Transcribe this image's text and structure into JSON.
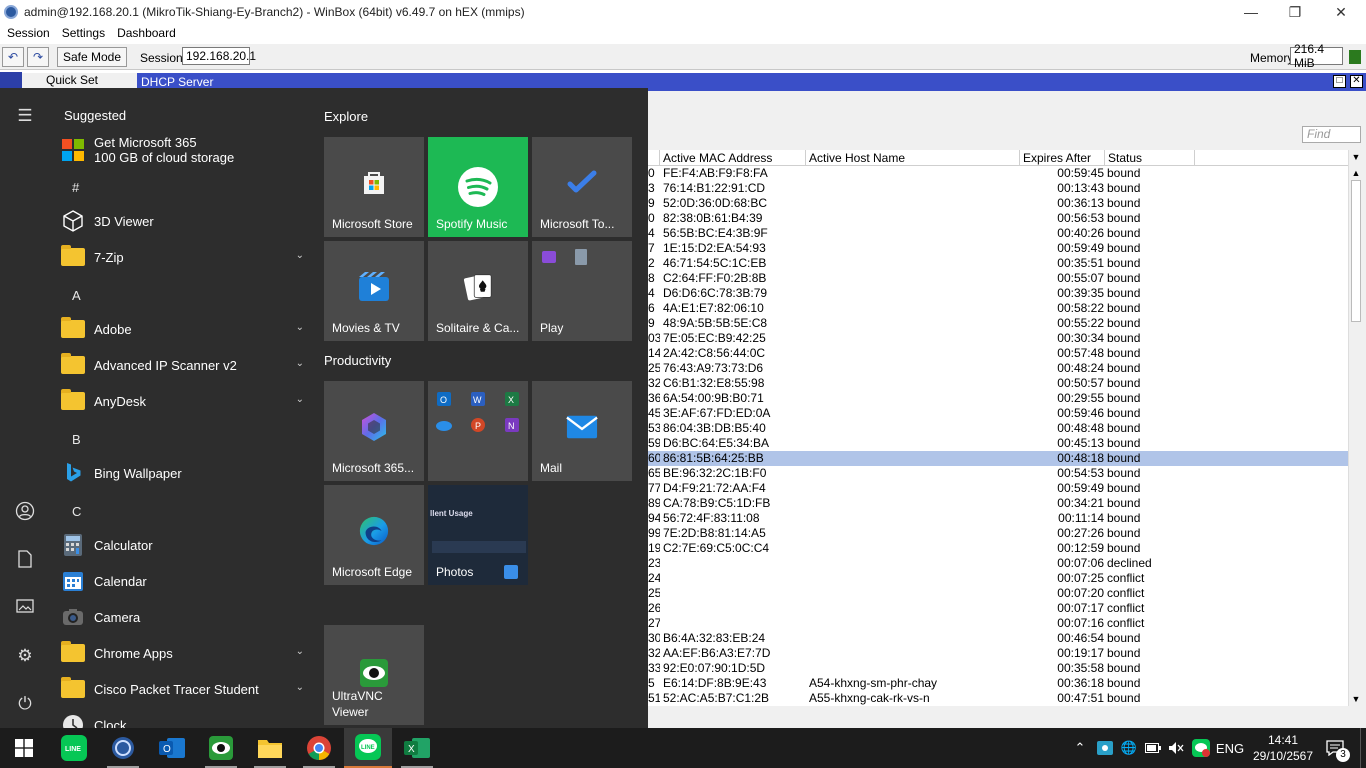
{
  "window": {
    "title": "admin@192.168.20.1 (MikroTik-Shiang-Ey-Branch2) - WinBox (64bit) v6.49.7 on hEX (mmips)",
    "minimize": "—",
    "restore": "❐",
    "close": "✕"
  },
  "menu": {
    "session": "Session",
    "settings": "Settings",
    "dashboard": "Dashboard"
  },
  "toolbar": {
    "undo": "↶",
    "redo": "↷",
    "safe_mode": "Safe Mode",
    "session_label": "Session:",
    "session_value": "192.168.20.1",
    "memory_label": "Memory:",
    "memory_value": "216.4 MiB"
  },
  "quickset": "Quick Set",
  "dhcp": {
    "title": "DHCP Server",
    "find_placeholder": "Find",
    "columns": {
      "mac": "Active MAC Address",
      "host": "Active Host Name",
      "expires": "Expires After",
      "status": "Status"
    },
    "rows": [
      {
        "id": "0",
        "mac": "FE:F4:AB:F9:F8:FA",
        "host": "",
        "expires": "00:59:45",
        "status": "bound"
      },
      {
        "id": "3",
        "mac": "76:14:B1:22:91:CD",
        "host": "",
        "expires": "00:13:43",
        "status": "bound"
      },
      {
        "id": "9",
        "mac": "52:0D:36:0D:68:BC",
        "host": "",
        "expires": "00:36:13",
        "status": "bound"
      },
      {
        "id": "0",
        "mac": "82:38:0B:61:B4:39",
        "host": "",
        "expires": "00:56:53",
        "status": "bound"
      },
      {
        "id": "4",
        "mac": "56:5B:BC:E4:3B:9F",
        "host": "",
        "expires": "00:40:26",
        "status": "bound"
      },
      {
        "id": "7",
        "mac": "1E:15:D2:EA:54:93",
        "host": "",
        "expires": "00:59:49",
        "status": "bound"
      },
      {
        "id": "2",
        "mac": "46:71:54:5C:1C:EB",
        "host": "",
        "expires": "00:35:51",
        "status": "bound"
      },
      {
        "id": "8",
        "mac": "C2:64:FF:F0:2B:8B",
        "host": "",
        "expires": "00:55:07",
        "status": "bound"
      },
      {
        "id": "4",
        "mac": "D6:D6:6C:78:3B:79",
        "host": "",
        "expires": "00:39:35",
        "status": "bound"
      },
      {
        "id": "6",
        "mac": "4A:E1:E7:82:06:10",
        "host": "",
        "expires": "00:58:22",
        "status": "bound"
      },
      {
        "id": "9",
        "mac": "48:9A:5B:5B:5E:C8",
        "host": "",
        "expires": "00:55:22",
        "status": "bound"
      },
      {
        "id": "03",
        "mac": "7E:05:EC:B9:42:25",
        "host": "",
        "expires": "00:30:34",
        "status": "bound"
      },
      {
        "id": "14",
        "mac": "2A:42:C8:56:44:0C",
        "host": "",
        "expires": "00:57:48",
        "status": "bound"
      },
      {
        "id": "25",
        "mac": "76:43:A9:73:73:D6",
        "host": "",
        "expires": "00:48:24",
        "status": "bound"
      },
      {
        "id": "32",
        "mac": "C6:B1:32:E8:55:98",
        "host": "",
        "expires": "00:50:57",
        "status": "bound"
      },
      {
        "id": "36",
        "mac": "6A:54:00:9B:B0:71",
        "host": "",
        "expires": "00:29:55",
        "status": "bound"
      },
      {
        "id": "45",
        "mac": "3E:AF:67:FD:ED:0A",
        "host": "",
        "expires": "00:59:46",
        "status": "bound"
      },
      {
        "id": "53",
        "mac": "86:04:3B:DB:B5:40",
        "host": "",
        "expires": "00:48:48",
        "status": "bound"
      },
      {
        "id": "59",
        "mac": "D6:BC:64:E5:34:BA",
        "host": "",
        "expires": "00:45:13",
        "status": "bound"
      },
      {
        "id": "60",
        "mac": "86:81:5B:64:25:BB",
        "host": "",
        "expires": "00:48:18",
        "status": "bound"
      },
      {
        "id": "65",
        "mac": "BE:96:32:2C:1B:F0",
        "host": "",
        "expires": "00:54:53",
        "status": "bound"
      },
      {
        "id": "77",
        "mac": "D4:F9:21:72:AA:F4",
        "host": "",
        "expires": "00:59:49",
        "status": "bound"
      },
      {
        "id": "89",
        "mac": "CA:78:B9:C5:1D:FB",
        "host": "",
        "expires": "00:34:21",
        "status": "bound"
      },
      {
        "id": "94",
        "mac": "56:72:4F:83:11:08",
        "host": "",
        "expires": "00:11:14",
        "status": "bound"
      },
      {
        "id": "99",
        "mac": "7E:2D:B8:81:14:A5",
        "host": "",
        "expires": "00:27:26",
        "status": "bound"
      },
      {
        "id": "19",
        "mac": "C2:7E:69:C5:0C:C4",
        "host": "",
        "expires": "00:12:59",
        "status": "bound"
      },
      {
        "id": "23",
        "mac": "",
        "host": "",
        "expires": "00:07:06",
        "status": "declined"
      },
      {
        "id": "24",
        "mac": "",
        "host": "",
        "expires": "00:07:25",
        "status": "conflict"
      },
      {
        "id": "25",
        "mac": "",
        "host": "",
        "expires": "00:07:20",
        "status": "conflict"
      },
      {
        "id": "26",
        "mac": "",
        "host": "",
        "expires": "00:07:17",
        "status": "conflict"
      },
      {
        "id": "27",
        "mac": "",
        "host": "",
        "expires": "00:07:16",
        "status": "conflict"
      },
      {
        "id": "30",
        "mac": "B6:4A:32:83:EB:24",
        "host": "",
        "expires": "00:46:54",
        "status": "bound"
      },
      {
        "id": "32",
        "mac": "AA:EF:B6:A3:E7:7D",
        "host": "",
        "expires": "00:19:17",
        "status": "bound"
      },
      {
        "id": "33",
        "mac": "92:E0:07:90:1D:5D",
        "host": "",
        "expires": "00:35:58",
        "status": "bound"
      },
      {
        "id": "5",
        "mac": "E6:14:DF:8B:9E:43",
        "host": "A54-khxng-sm-phr-chay",
        "expires": "00:36:18",
        "status": "bound"
      },
      {
        "id": "51",
        "mac": "52:AC:A5:B7:C1:2B",
        "host": "A55-khxng-cak-rk-vs-n",
        "expires": "00:47:51",
        "status": "bound"
      }
    ],
    "selected_index": 19
  },
  "start": {
    "suggested": "Suggested",
    "ms365_line1": "Get Microsoft 365",
    "ms365_line2": "100 GB of cloud storage",
    "letters": {
      "hash": "#",
      "a": "A",
      "b": "B",
      "c": "C"
    },
    "apps": {
      "viewer3d": "3D Viewer",
      "zip7": "7-Zip",
      "adobe": "Adobe",
      "advip": "Advanced IP Scanner v2",
      "anydesk": "AnyDesk",
      "bing": "Bing Wallpaper",
      "calculator": "Calculator",
      "calendar": "Calendar",
      "camera": "Camera",
      "chromeapps": "Chrome Apps",
      "cisco": "Cisco Packet Tracer Student",
      "clock": "Clock"
    },
    "explore": "Explore",
    "productivity": "Productivity",
    "tiles": {
      "store": "Microsoft Store",
      "spotify": "Spotify Music",
      "todo": "Microsoft To...",
      "movies": "Movies & TV",
      "solitaire": "Solitaire & Ca...",
      "play": "Play",
      "m365": "Microsoft 365...",
      "mail": "Mail",
      "edge": "Microsoft Edge",
      "photos": "Photos",
      "photos_peek_title": "llent Usage",
      "uvnc_line1": "UltraVNC",
      "uvnc_line2": "Viewer"
    }
  },
  "taskbar": {
    "lang": "ENG",
    "time": "14:41",
    "date": "29/10/2567",
    "notif_count": "3",
    "line_text": "LINE"
  },
  "colors": {
    "accent": "#3a4fc8",
    "spotify": "#1db954",
    "selection": "#b0c4e8"
  }
}
